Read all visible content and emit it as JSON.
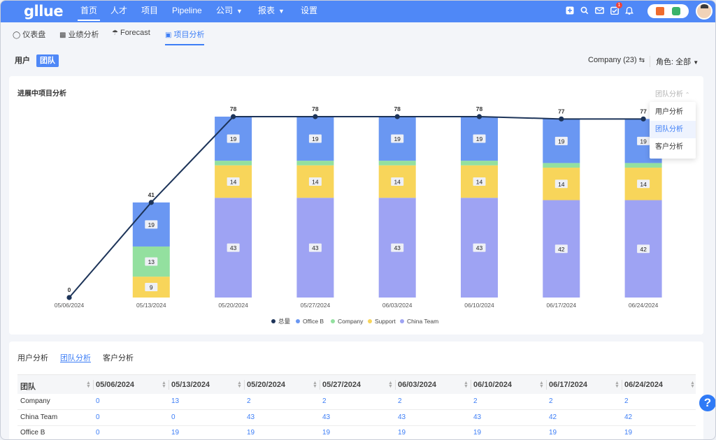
{
  "nav": {
    "logo": "gllue",
    "items": [
      "首页",
      "人才",
      "项目",
      "Pipeline",
      "公司",
      "报表",
      "设置"
    ],
    "badge_count": "1"
  },
  "subtabs": [
    "仪表盘",
    "业绩分析",
    "Forecast",
    "项目分析"
  ],
  "toggle": {
    "user": "用户",
    "team": "团队"
  },
  "filters": {
    "company": "Company (23)",
    "role": "角色: 全部"
  },
  "chart_card": {
    "title": "进展中项目分析",
    "dropdown_label": "团队分析",
    "dropdown_items": [
      "用户分析",
      "团队分析",
      "客户分析"
    ]
  },
  "chart_data": {
    "type": "bar",
    "stacked": true,
    "categories": [
      "05/06/2024",
      "05/13/2024",
      "05/20/2024",
      "05/27/2024",
      "06/03/2024",
      "06/10/2024",
      "06/17/2024",
      "06/24/2024"
    ],
    "series": [
      {
        "name": "China Team",
        "color": "#9ea3f3",
        "values": [
          0,
          0,
          43,
          43,
          43,
          43,
          42,
          42
        ]
      },
      {
        "name": "Support",
        "color": "#f8d55a",
        "values": [
          0,
          9,
          14,
          14,
          14,
          14,
          14,
          14
        ]
      },
      {
        "name": "Company",
        "color": "#93e09f",
        "values": [
          0,
          13,
          2,
          2,
          2,
          2,
          2,
          2
        ]
      },
      {
        "name": "Office B",
        "color": "#6a97f2",
        "values": [
          0,
          19,
          19,
          19,
          19,
          19,
          19,
          19
        ]
      }
    ],
    "line": {
      "name": "总量",
      "color": "#1d3459",
      "values": [
        0,
        41,
        78,
        78,
        78,
        78,
        77,
        77
      ]
    },
    "legend": [
      "总量",
      "Office B",
      "Company",
      "Support",
      "China Team"
    ],
    "ylim": [
      0,
      78
    ],
    "grid": false
  },
  "table": {
    "tabs": [
      "用户分析",
      "团队分析",
      "客户分析"
    ],
    "headers": [
      "团队",
      "05/06/2024",
      "05/13/2024",
      "05/20/2024",
      "05/27/2024",
      "06/03/2024",
      "06/10/2024",
      "06/17/2024",
      "06/24/2024"
    ],
    "rows": [
      [
        "Company",
        "0",
        "13",
        "2",
        "2",
        "2",
        "2",
        "2",
        "2"
      ],
      [
        "China Team",
        "0",
        "0",
        "43",
        "43",
        "43",
        "43",
        "42",
        "42"
      ],
      [
        "Office B",
        "0",
        "19",
        "19",
        "19",
        "19",
        "19",
        "19",
        "19"
      ]
    ]
  },
  "help": "?"
}
